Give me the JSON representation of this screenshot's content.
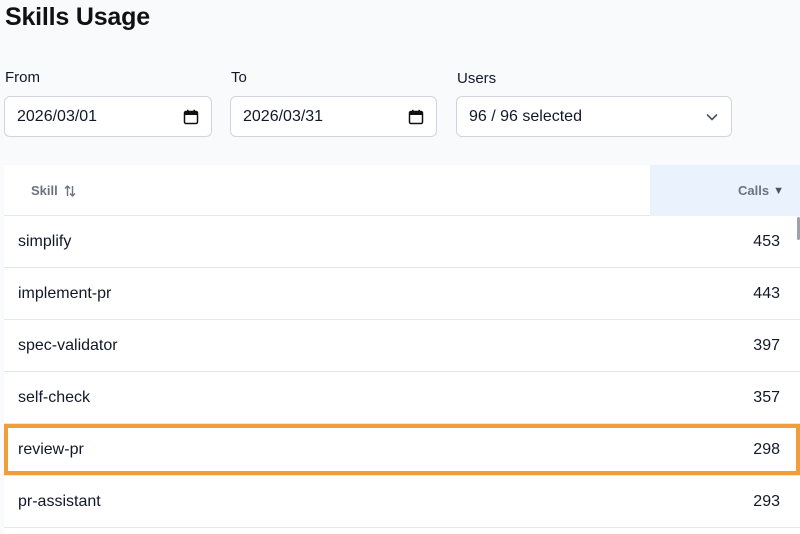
{
  "page": {
    "title": "Skills Usage"
  },
  "filters": {
    "from": {
      "label": "From",
      "value": "2026/03/01"
    },
    "to": {
      "label": "To",
      "value": "2026/03/31"
    },
    "users": {
      "label": "Users",
      "value": "96 / 96 selected"
    }
  },
  "table": {
    "columns": {
      "skill": "Skill",
      "calls": "Calls"
    },
    "sort": {
      "column": "calls",
      "direction": "desc"
    },
    "rows": [
      {
        "skill": "simplify",
        "calls": "453"
      },
      {
        "skill": "implement-pr",
        "calls": "443"
      },
      {
        "skill": "spec-validator",
        "calls": "397"
      },
      {
        "skill": "self-check",
        "calls": "357"
      },
      {
        "skill": "review-pr",
        "calls": "298",
        "highlighted": true
      },
      {
        "skill": "pr-assistant",
        "calls": "293"
      }
    ]
  },
  "colors": {
    "highlight_border": "#f29e38",
    "sorted_header_bg": "#eaf2fd"
  },
  "icons": {
    "date_picker": "calendar-icon",
    "users_dropdown": "chevron-down-icon",
    "skill_sort": "sort-arrows-icon",
    "calls_sort": "sort-desc-icon"
  }
}
